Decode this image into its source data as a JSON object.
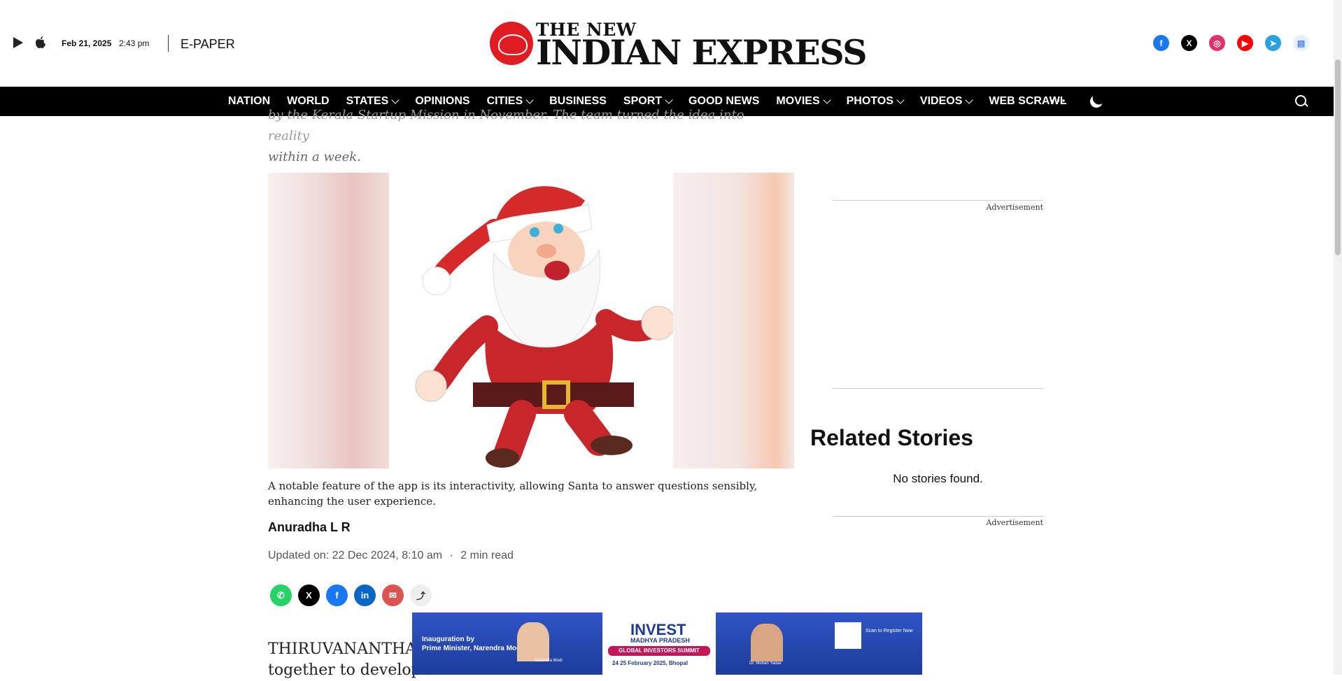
{
  "header": {
    "date": "Feb 21, 2025",
    "time": "2:43 pm",
    "epaper": "E-PAPER",
    "logo_top": "THE NEW",
    "logo_main": "INDIAN EXPRESS",
    "store_icons": [
      "google-play-icon",
      "apple-icon"
    ],
    "social_icons": [
      "facebook-icon",
      "x-icon",
      "instagram-icon",
      "youtube-icon",
      "telegram-icon",
      "google-news-icon"
    ]
  },
  "nav": {
    "items": [
      {
        "label": "NATION"
      },
      {
        "label": "WORLD"
      },
      {
        "label": "STATES"
      },
      {
        "label": "OPINIONS"
      },
      {
        "label": "CITIES"
      },
      {
        "label": "BUSINESS"
      },
      {
        "label": "SPORT"
      },
      {
        "label": "GOOD NEWS"
      },
      {
        "label": "MOVIES"
      },
      {
        "label": "PHOTOS"
      },
      {
        "label": "VIDEOS"
      },
      {
        "label": "WEB SCRAWL"
      }
    ],
    "more": "···"
  },
  "article": {
    "subhead_cut": "by the Kerala Startup Mission in November. The team turned the idea into reality",
    "subhead_line": "within a week.",
    "caption": "A notable feature of the app is its interactivity, allowing Santa to answer questions sensibly, enhancing the user experience.",
    "author": "Anuradha L R",
    "updated": "Updated on: 22 Dec 2024, 8:10 am",
    "read_time": "2 min read",
    "separator": "·",
    "body_line1": "THIRUVANANTHAPU",
    "body_line2": "together to develop a"
  },
  "sidebar": {
    "advertisement": "Advertisement",
    "related_title": "Related Stories",
    "no_stories": "No stories found."
  },
  "banner": {
    "inauguration": "Inauguration by",
    "pm": "Prime Minister, Narendra Modi",
    "pm_name": "Narendra Modi",
    "invest": "INVEST",
    "mp": "MADHYA PRADESH",
    "summit": "GLOBAL INVESTORS SUMMIT",
    "summit_date": "24 25 February 2025, Bhopal",
    "cm_name": "Dr. Mohan Yadav",
    "scan": "Scan to Register Now"
  },
  "colors": {
    "facebook": "#1877f2",
    "x": "#000000",
    "instagram": "#e1306c",
    "youtube": "#ff0000",
    "telegram": "#2aa1e0",
    "whatsapp": "#25d366",
    "linkedin": "#0a66c2",
    "email": "#d9534f",
    "logo_red": "#e11b22"
  }
}
